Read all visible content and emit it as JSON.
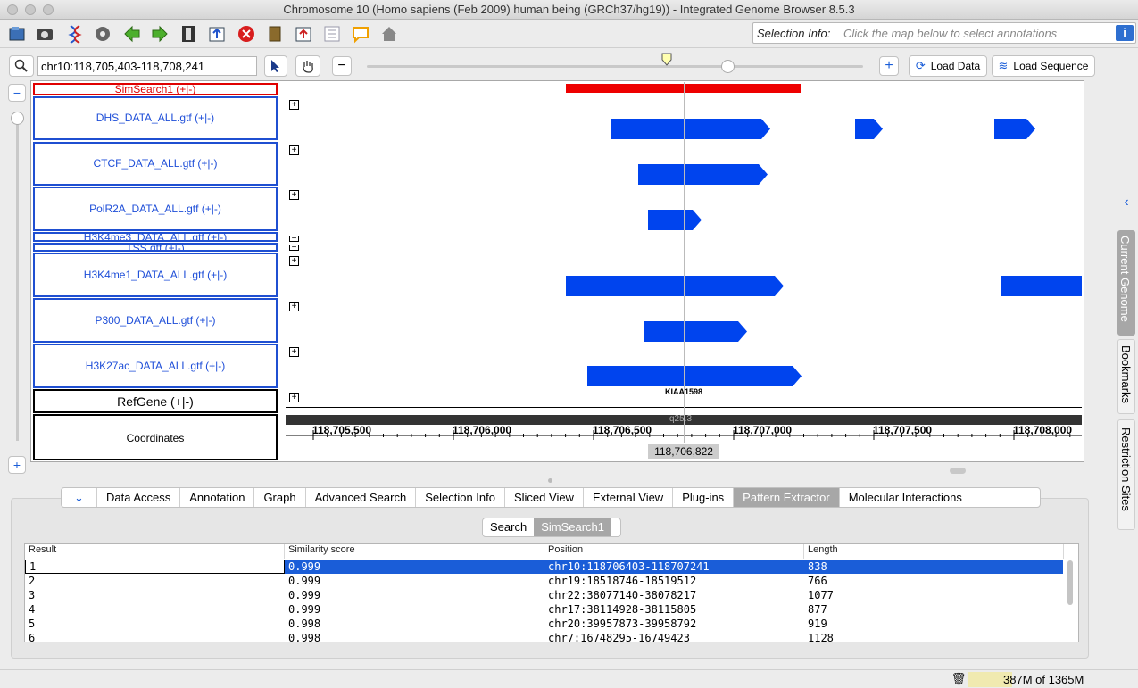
{
  "window": {
    "title": "Chromosome 10  (Homo sapiens (Feb 2009) human being (GRCh37/hg19)) - Integrated Genome Browser 8.5.3"
  },
  "toolbar": {
    "icons": [
      "open-file-icon",
      "camera-icon",
      "dna-icon",
      "gear-icon",
      "back-arrow-icon",
      "forward-arrow-icon",
      "film-icon",
      "export-icon",
      "stop-icon",
      "book-icon",
      "upload-icon",
      "list-icon",
      "comment-icon",
      "home-icon"
    ],
    "selection_info_label": "Selection Info:",
    "selection_info_value": "Click the map below to select annotations",
    "info_glyph": "i"
  },
  "nav": {
    "location": "chr10:118,705,403-118,708,241",
    "load_data": "Load Data",
    "load_sequence": "Load Sequence"
  },
  "tracks": [
    {
      "label": "SimSearch1 (+|-)",
      "color": "#e00000"
    },
    {
      "label": "DHS_DATA_ALL.gtf (+|-)"
    },
    {
      "label": "CTCF_DATA_ALL.gtf (+|-)"
    },
    {
      "label": "PolR2A_DATA_ALL.gtf (+|-)"
    },
    {
      "label": "H3K4me3_DATA_ALL.gtf (+|-)"
    },
    {
      "label": "TSS.gtf (+|-)"
    },
    {
      "label": "H3K4me1_DATA_ALL.gtf (+|-)"
    },
    {
      "label": "P300_DATA_ALL.gtf (+|-)"
    },
    {
      "label": "H3K27ac_DATA_ALL.gtf (+|-)"
    },
    {
      "label": "RefGene (+|-)"
    },
    {
      "label": "Coordinates"
    }
  ],
  "gene_label": "KIAA1598",
  "band_label": "q25.3",
  "ruler_ticks": [
    "118,705,500",
    "118,706,000",
    "118,706,500",
    "118,707,000",
    "118,707,500",
    "118,708,000"
  ],
  "cursor_position": "118,706,822",
  "bottom_tabs": [
    "Data Access",
    "Annotation",
    "Graph",
    "Advanced Search",
    "Selection Info",
    "Sliced View",
    "External View",
    "Plug-ins",
    "Pattern Extractor",
    "Molecular Interactions"
  ],
  "sub_tabs": [
    "Search",
    "SimSearch1"
  ],
  "results_table": {
    "columns": [
      "Result",
      "Similarity score",
      "Position",
      "Length"
    ],
    "rows": [
      [
        "1",
        "0.999",
        "chr10:118706403-118707241",
        "838"
      ],
      [
        "2",
        "0.999",
        "chr19:18518746-18519512",
        "766"
      ],
      [
        "3",
        "0.999",
        "chr22:38077140-38078217",
        "1077"
      ],
      [
        "4",
        "0.999",
        "chr17:38114928-38115805",
        "877"
      ],
      [
        "5",
        "0.998",
        "chr20:39957873-39958792",
        "919"
      ],
      [
        "6",
        "0.998",
        "chr7:16748295-16749423",
        "1128"
      ]
    ]
  },
  "side_tabs": [
    "Current Genome",
    "Bookmarks",
    "Restriction Sites"
  ],
  "status": {
    "memory": "387M of 1365M"
  },
  "colors": {
    "feature": "#0044ee",
    "simsearch": "#ee0000",
    "selection": "#1a5dd8"
  }
}
